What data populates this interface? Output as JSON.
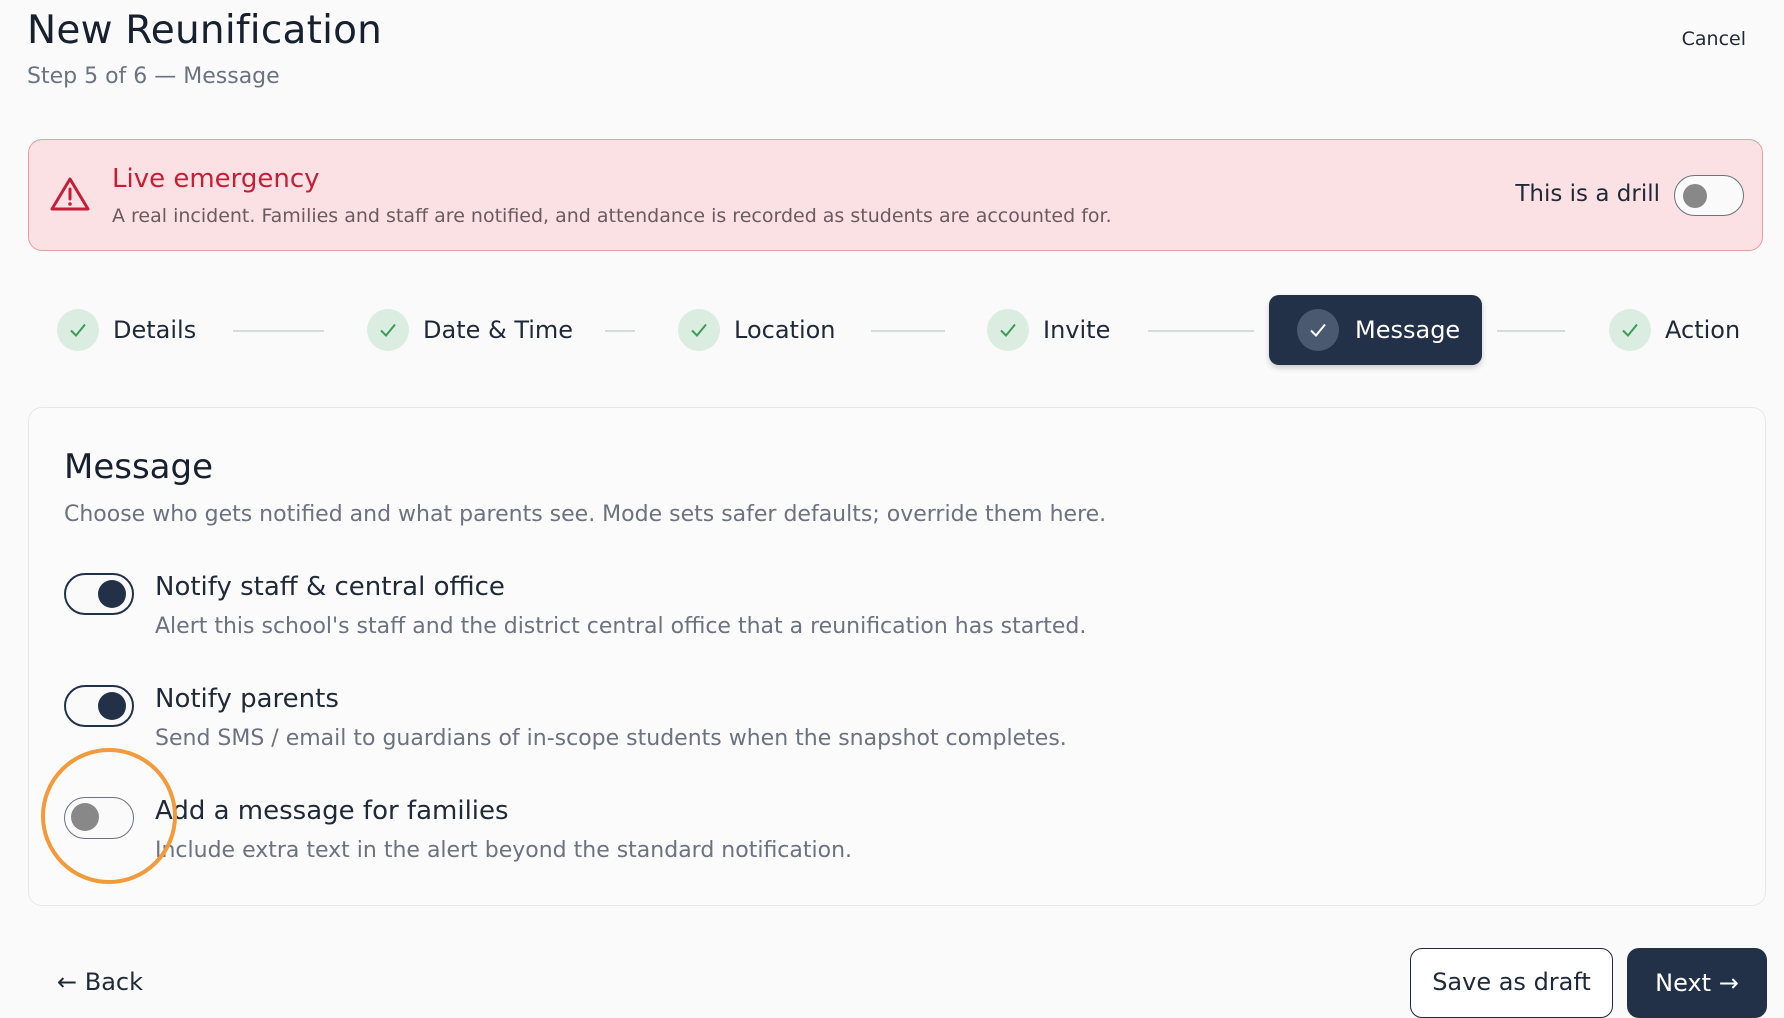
{
  "header": {
    "title": "New Reunification",
    "subtitle": "Step 5 of 6 — Message",
    "cancel_label": "Cancel"
  },
  "banner": {
    "title": "Live emergency",
    "description": "A real incident. Families and staff are notified, and attendance is recorded as students are accounted for.",
    "drill_label": "This is a drill",
    "drill_on": false,
    "icon": "warning-triangle-icon"
  },
  "stepper": {
    "steps": [
      {
        "label": "Details",
        "status": "complete"
      },
      {
        "label": "Date & Time",
        "status": "complete"
      },
      {
        "label": "Location",
        "status": "complete"
      },
      {
        "label": "Invite",
        "status": "complete"
      },
      {
        "label": "Message",
        "status": "active"
      },
      {
        "label": "Action",
        "status": "complete"
      }
    ]
  },
  "card": {
    "title": "Message",
    "description": "Choose who gets notified and what parents see. Mode sets safer defaults; override them here.",
    "options": [
      {
        "title": "Notify staff & central office",
        "description": "Alert this school's staff and the district central office that a reunification has started.",
        "on": true
      },
      {
        "title": "Notify parents",
        "description": "Send SMS / email to guardians of in-scope students when the snapshot completes.",
        "on": true
      },
      {
        "title": "Add a message for families",
        "description": "Include extra text in the alert beyond the standard notification.",
        "on": false
      }
    ]
  },
  "footer": {
    "back_label": "← Back",
    "save_draft_label": "Save as draft",
    "next_label": "Next →"
  },
  "colors": {
    "primary": "#223147",
    "danger": "#c51f38",
    "banner_bg": "#fbe0e4",
    "check_bg": "#dbece1",
    "check_stroke": "#3f9a5a",
    "focus_ring": "#f39a3c"
  }
}
